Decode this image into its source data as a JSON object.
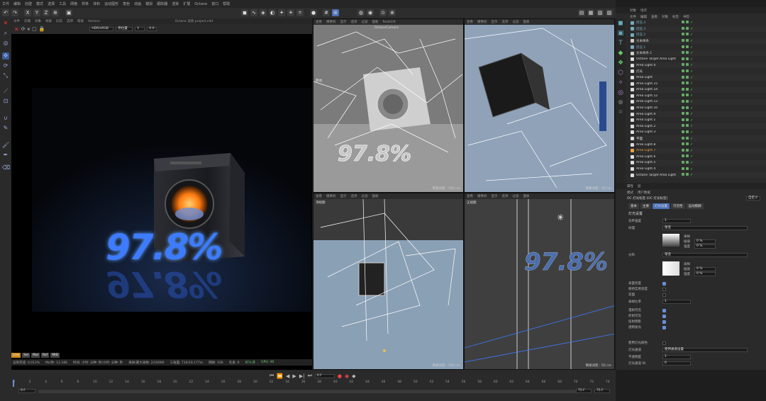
{
  "menu": [
    "文件",
    "编辑",
    "创建",
    "模式",
    "选择",
    "工具",
    "网格",
    "样条",
    "体积",
    "运动图形",
    "角色",
    "动画",
    "模拟",
    "跟踪器",
    "渲染",
    "扩展",
    "Octane",
    "窗口",
    "帮助"
  ],
  "toolbar_icons": [
    "undo-icon",
    "redo-icon",
    "select-icon",
    "move-icon",
    "scale-icon",
    "rotate-icon",
    "recent-icon"
  ],
  "render_view": {
    "menu": [
      "文件",
      "云端",
      "对象",
      "材质",
      "比较",
      "选项",
      "帮助",
      "Vectors"
    ],
    "mode": "HDR/sRGB",
    "lut": "原位置",
    "value1": "1",
    "value2": "0.0",
    "title": "Octane 渲染 project.c4d",
    "badges": [
      "Live",
      "Sel",
      "Mal",
      "Ref",
      "MtB"
    ],
    "status": {
      "progress": "渲染完成: 0.012%",
      "ms": "Ms/秒: 12.166",
      "time": "时间: 小时: 分钟: 秒/小时: 分钟: 秒",
      "samples": "采样/最大采样: 2/16000",
      "tris": "三角面: 716/19.177m",
      "meshes": "网格: 106",
      "hair": "毛发: 0",
      "rtx": "RTX:开",
      "gpu": "GPU: 46"
    }
  },
  "viewports": [
    {
      "label": "透视视图",
      "menu": [
        "查看",
        "摄像机",
        "显示",
        "选项",
        "过滤",
        "面板",
        "Redshift"
      ],
      "camera": "OctaneCamera",
      "scale": "网格间距 : 500 cm",
      "tag": "移动"
    },
    {
      "label": "",
      "menu": [
        "查看",
        "摄像机",
        "显示",
        "选项",
        "过滤",
        "面板"
      ],
      "camera": "",
      "scale": "网格间距 : 50 cm",
      "tag": ""
    },
    {
      "label": "顶视图",
      "menu": [
        "查看",
        "摄像机",
        "显示",
        "选项",
        "过滤",
        "面板"
      ],
      "camera": "",
      "scale": "网格间距 : 500 cm",
      "tag": ""
    },
    {
      "label": "正视图",
      "menu": [
        "查看",
        "摄像机",
        "显示",
        "选项",
        "过滤",
        "面板"
      ],
      "camera": "",
      "scale": "网格间距 : 50 cm",
      "tag": ""
    }
  ],
  "object_panel": {
    "tabs": [
      "对象",
      "场次"
    ],
    "menu": [
      "文件",
      "编辑",
      "查看",
      "对象",
      "标签",
      "书签"
    ],
    "items": [
      {
        "name": "挤压.4",
        "color": "#7ab"
      },
      {
        "name": "挤压.3",
        "color": "#7ab"
      },
      {
        "name": "挤压.2",
        "color": "#7ab"
      },
      {
        "name": "文本样条",
        "color": "#ccc"
      },
      {
        "name": "挤压.1",
        "color": "#7ab"
      },
      {
        "name": "文本样条.1",
        "color": "#ccc"
      },
      {
        "name": "Octane Target Area Light",
        "color": "#ddd"
      },
      {
        "name": "Area Light.4",
        "color": "#ddd"
      },
      {
        "name": "灯光",
        "color": "#ddd"
      },
      {
        "name": "Area Light",
        "color": "#ddd"
      },
      {
        "name": "Area Light.15",
        "color": "#ddd"
      },
      {
        "name": "Area Light.14",
        "color": "#ddd"
      },
      {
        "name": "Area Light.12",
        "color": "#ddd"
      },
      {
        "name": "Area Light.13",
        "color": "#ddd"
      },
      {
        "name": "Area Light.10",
        "color": "#ddd"
      },
      {
        "name": "Area Light.9",
        "color": "#ddd"
      },
      {
        "name": "Area Light.1",
        "color": "#ddd"
      },
      {
        "name": "Area Light.2",
        "color": "#ddd"
      },
      {
        "name": "Area Light.3",
        "color": "#ddd"
      },
      {
        "name": "平面",
        "color": "#ddd"
      },
      {
        "name": "Area Light.8",
        "color": "#ddd"
      },
      {
        "name": "Area Light.7",
        "color": "#e8a040"
      },
      {
        "name": "Area Light.6",
        "color": "#ddd"
      },
      {
        "name": "Area Light.5",
        "color": "#ddd"
      },
      {
        "name": "Area Light.4",
        "color": "#ddd"
      },
      {
        "name": "Octane Target Area Light",
        "color": "#ddd"
      }
    ]
  },
  "attributes": {
    "tabs": [
      "属性",
      "层"
    ],
    "menu": [
      "模式",
      "用户数据"
    ],
    "object_title": "OC 灯光标签 [OC 灯光标签]",
    "preset": "自定义",
    "subtabs": [
      "基本",
      "主要",
      "灯光设置",
      "可见性",
      "运动模糊"
    ],
    "section": "灯光设置",
    "rows": [
      {
        "label": "功率强度",
        "value": "1"
      },
      {
        "label": "纹理",
        "value": "渐变"
      },
      {
        "label": "分布",
        "value": "渐变"
      },
      {
        "label": "表面亮度",
        "check": true
      },
      {
        "label": "保持实例亮度",
        "check": false
      },
      {
        "label": "双面",
        "check": false
      },
      {
        "label": "采样比率",
        "value": "1"
      },
      {
        "label": "漫射可见",
        "check": true
      },
      {
        "label": "折射可见",
        "check": true
      },
      {
        "label": "投射阴影",
        "check": true
      },
      {
        "label": "透明发光",
        "check": true
      },
      {
        "label": "使用灯光颜色",
        "check": false
      },
      {
        "label": "灯光通道",
        "value": "使用通道设置"
      },
      {
        "label": "不透明度",
        "value": "1"
      },
      {
        "label": "灯光通道 ID",
        "value": "0"
      }
    ],
    "gradient_sub": [
      "采样",
      "插值",
      "强度"
    ],
    "gradient_pct": "0 %"
  },
  "timeline": {
    "ticks": [
      "0",
      "2",
      "4",
      "6",
      "8",
      "10",
      "12",
      "14",
      "16",
      "18",
      "20",
      "22",
      "24",
      "26",
      "28",
      "30",
      "32",
      "34",
      "36",
      "38",
      "40",
      "42",
      "44",
      "46",
      "48",
      "50",
      "52",
      "54",
      "56",
      "58",
      "60",
      "62",
      "64",
      "66",
      "68",
      "70",
      "72",
      "74"
    ],
    "current": "0 F",
    "start": "0 F",
    "end": "75 F",
    "max": "75 F",
    "frame_field": "0 F"
  },
  "render_text": "97.8%",
  "colors": {
    "accent": "#4a7fd8",
    "orange": "#ff8a20",
    "blue_text": "#3d7bff"
  }
}
